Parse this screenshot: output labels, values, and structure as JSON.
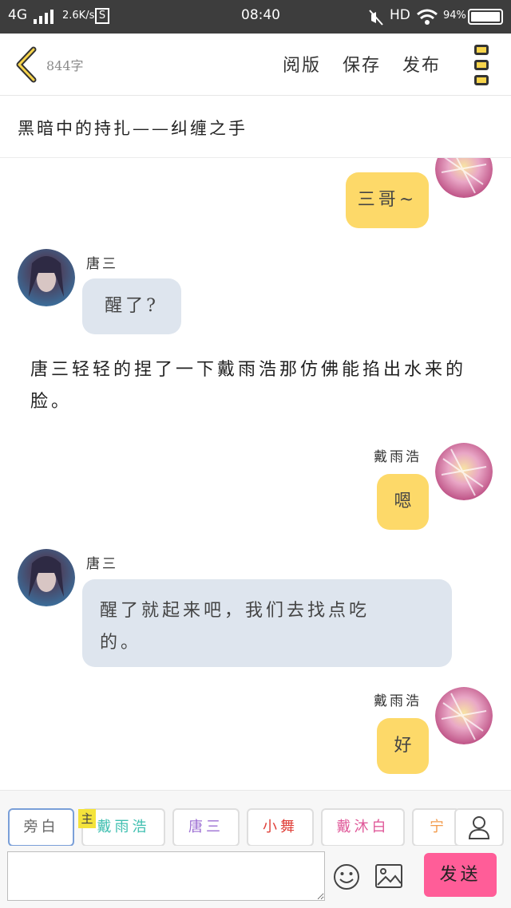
{
  "status_bar": {
    "network": "4G",
    "speed": "2.6K/s",
    "sim": "S",
    "time": "08:40",
    "hd": "HD",
    "battery": "94%"
  },
  "toolbar": {
    "word_count": "844字",
    "actions": [
      "阅版",
      "保存",
      "发布"
    ]
  },
  "story": {
    "title": "黑暗中的持扎——纠缠之手"
  },
  "messages": [
    {
      "type": "right",
      "speaker": "",
      "text": "三哥~"
    },
    {
      "type": "left",
      "speaker": "唐三",
      "text": "醒了?"
    },
    {
      "type": "narration",
      "text": "唐三轻轻的捏了一下戴雨浩那仿佛能掐出水来的脸。"
    },
    {
      "type": "right",
      "speaker": "戴雨浩",
      "text": "嗯"
    },
    {
      "type": "left",
      "speaker": "唐三",
      "text": "醒了就起来吧，我们去找点吃的。"
    },
    {
      "type": "right",
      "speaker": "戴雨浩",
      "text": "好"
    }
  ],
  "roles": {
    "chips": [
      {
        "label": "旁白",
        "color": "#555555"
      },
      {
        "label": "戴雨浩",
        "color": "#3fbfb0"
      },
      {
        "label": "唐三",
        "color": "#9d6fd3"
      },
      {
        "label": "小舞",
        "color": "#e0413a"
      },
      {
        "label": "戴沐白",
        "color": "#e05a9a"
      },
      {
        "label": "宁荣",
        "color": "#f29b4c"
      }
    ],
    "main_badge": "主"
  },
  "input": {
    "value": "",
    "send_label": "发送"
  },
  "colors": {
    "accent_yellow": "#fdd969",
    "left_bubble": "#dee5ee",
    "send_button": "#ff5d98"
  }
}
